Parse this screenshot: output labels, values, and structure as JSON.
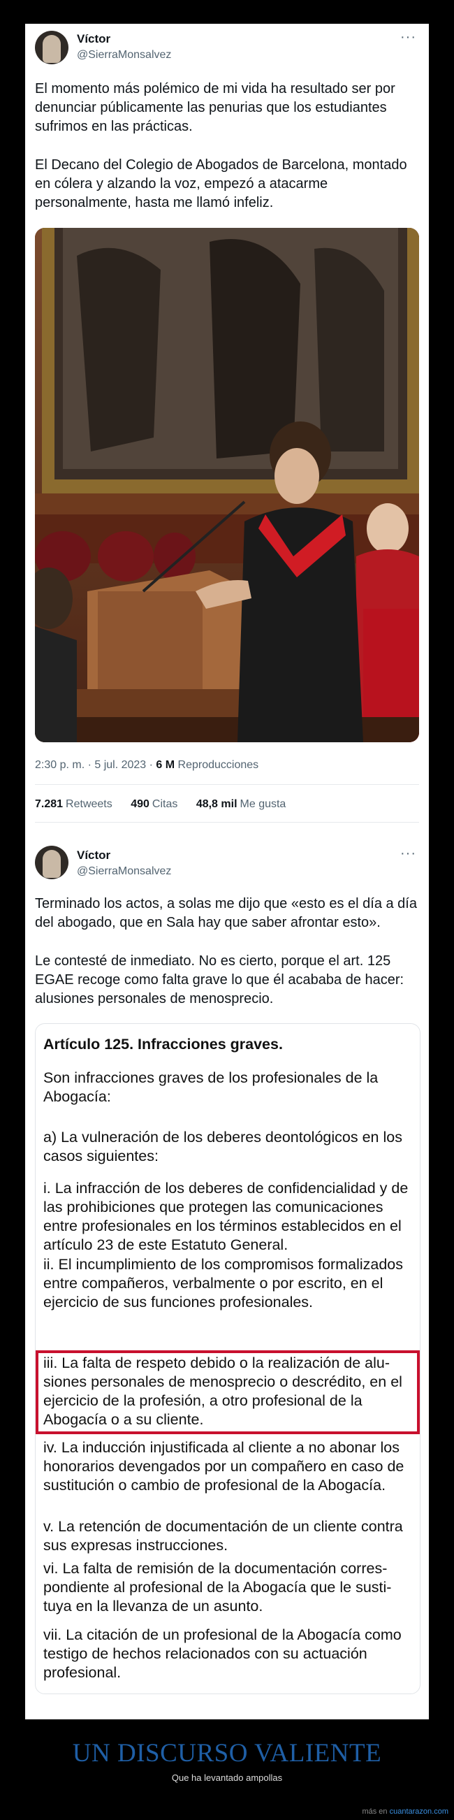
{
  "tweet1": {
    "author_name": "Víctor",
    "author_handle": "@SierraMonsalvez",
    "more": "···",
    "paragraph1": "El momento más polémico de mi vida ha resultado ser por denunciar públicamente las penurias que los estudiantes sufrimos en las prácticas.",
    "paragraph2": "El Decano del Colegio de Abogados de Barcelona, montado en cólera y alzando la voz, empezó a atacarme personalmente, hasta me llamó infeliz.",
    "timestamp": "2:30 p. m. · 5 jul. 2023 · ",
    "views_value": "6 M",
    "views_label": " Reproducciones",
    "stats": [
      {
        "value": "7.281",
        "label": "Retweets"
      },
      {
        "value": "490",
        "label": "Citas"
      },
      {
        "value": "48,8 mil",
        "label": "Me gusta"
      }
    ]
  },
  "tweet2": {
    "author_name": "Víctor",
    "author_handle": "@SierraMonsalvez",
    "more": "···",
    "paragraph1": "Terminado los actos, a solas me dijo que «esto es el día a día del abogado, que en Sala hay que saber afrontar esto».",
    "paragraph2": "Le contesté de inmediato. No es cierto, porque el art. 125 EGAE recoge como falta grave lo que él acababa de hacer: alusiones personales de menosprecio.",
    "document": {
      "title": "Artículo 125. Infracciones graves.",
      "intro": "Son infracciones graves de los profesionales de la Abogacía:",
      "a": "a) La vulneración de los deberes deontológicos en los casos siguientes:",
      "i": "i. La infracción de los deberes de confidencialidad y de las prohibiciones que protegen las comunicacio­nes entre profesionales en los términos establecidos en el artículo 23 de este Estatuto General.",
      "ii": "ii. El incumplimiento de los compromisos formaliza­dos entre compañeros, verbalmente o por escrito, en el ejercicio de sus funciones profesionales.",
      "iii": "iii. La falta de respeto debido o la realización de alu­siones personales de menosprecio o descrédito, en el ejercicio de la profesión, a otro profesional de la Abogacía o a su cliente.",
      "iv": "iv. La inducción injustificada al cliente a no abonar los honorarios devengados por un compañero en caso de sustitución o cambio de profesional de la Abogacía.",
      "v": "v. La retención de documentación de un cliente con­tra sus expresas instrucciones.",
      "vi": "vi. La falta de remisión de la documentación corres­pondiente al profesional de la Abogacía que le susti­tuya en la llevanza de un asunto.",
      "vii": "vii. La citación de un profesional de la Abogacía como testigo de hechos relacionados con su actua­ción profesional."
    }
  },
  "headline": "UN DISCURSO VALIENTE",
  "subline": "Que ha levantado ampollas",
  "footer_prefix": "más en ",
  "footer_brand": "cuantarazon.com",
  "colors": {
    "headline": "#1f5fa6",
    "highlight_border": "#c8102e",
    "brand_link": "#3a8fe0"
  }
}
